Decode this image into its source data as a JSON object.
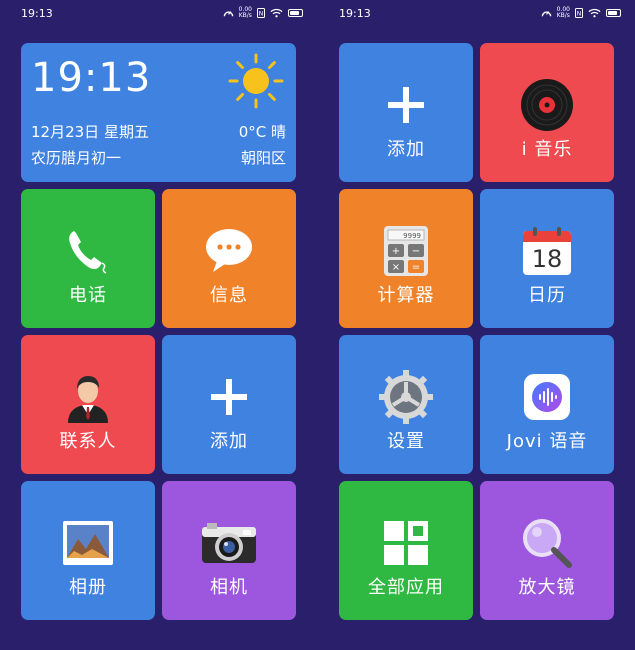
{
  "status_bar": {
    "time_left": "19:13",
    "time_right": "19:13",
    "net_speed_value": "0.00",
    "net_speed_unit": "KB/s"
  },
  "weather_widget": {
    "time": "19:13",
    "date": "12月23日 星期五",
    "lunar_date": "农历腊月初一",
    "temperature_condition": "0°C 晴",
    "location": "朝阳区"
  },
  "left_screen_tiles": [
    {
      "label": "电话",
      "icon": "phone-icon"
    },
    {
      "label": "信息",
      "icon": "message-icon"
    },
    {
      "label": "联系人",
      "icon": "contact-icon"
    },
    {
      "label": "添加",
      "icon": "plus-icon"
    },
    {
      "label": "相册",
      "icon": "gallery-icon"
    },
    {
      "label": "相机",
      "icon": "camera-icon"
    }
  ],
  "right_screen_tiles": [
    {
      "label": "添加",
      "icon": "plus-icon"
    },
    {
      "label": "i 音乐",
      "icon": "music-disc-icon"
    },
    {
      "label": "计算器",
      "icon": "calculator-icon"
    },
    {
      "label": "日历",
      "icon": "calendar-icon"
    },
    {
      "label": "设置",
      "icon": "gear-icon"
    },
    {
      "label": "Jovi 语音",
      "icon": "voice-assistant-icon"
    },
    {
      "label": "全部应用",
      "icon": "all-apps-icon"
    },
    {
      "label": "放大镜",
      "icon": "magnifier-icon"
    }
  ],
  "calendar_icon_day": "18",
  "colors": {
    "background": "#2a1f6b",
    "blue": "#3f82e0",
    "green": "#2fb842",
    "orange": "#f0832a",
    "red": "#ee4a4f",
    "purple": "#9c57de"
  }
}
